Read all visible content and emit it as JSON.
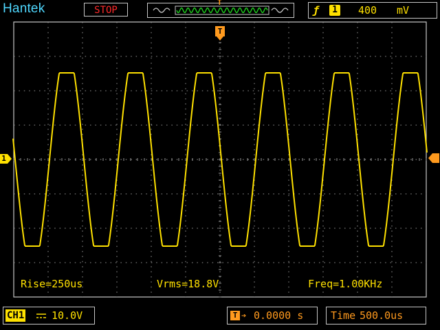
{
  "header": {
    "brand": "Hantek",
    "run_state": "STOP",
    "trigger_marker": "T",
    "trigger_source": "1",
    "trigger_level": "400",
    "trigger_unit": "mV",
    "trigger_slope_icon": "rising-edge-icon"
  },
  "screen": {
    "channel_marker": "1",
    "trigger_time_marker": "T",
    "waveform": {
      "type": "sine (clipped)",
      "color": "#ffe100",
      "frequency_khz": 1.0,
      "cycles_visible": 6
    }
  },
  "measurements": {
    "rise": "Rise=250us",
    "vrms": "Vrms=18.8V",
    "freq": "Freq=1.00KHz"
  },
  "status_bar": {
    "channel_label": "CH1",
    "coupling_icon": "dc-coupling-icon",
    "volts_div": "10.0V",
    "trigger_icon_label": "T",
    "trigger_position": "0.0000 s",
    "time_label": "Time",
    "time_div": "500.0us"
  },
  "colors": {
    "trace": "#ffe100",
    "accent_orange": "#ff9a1e",
    "brand_cyan": "#4fd8ff",
    "stop_red": "#ff2a2a",
    "grid": "#9a9a9a"
  }
}
